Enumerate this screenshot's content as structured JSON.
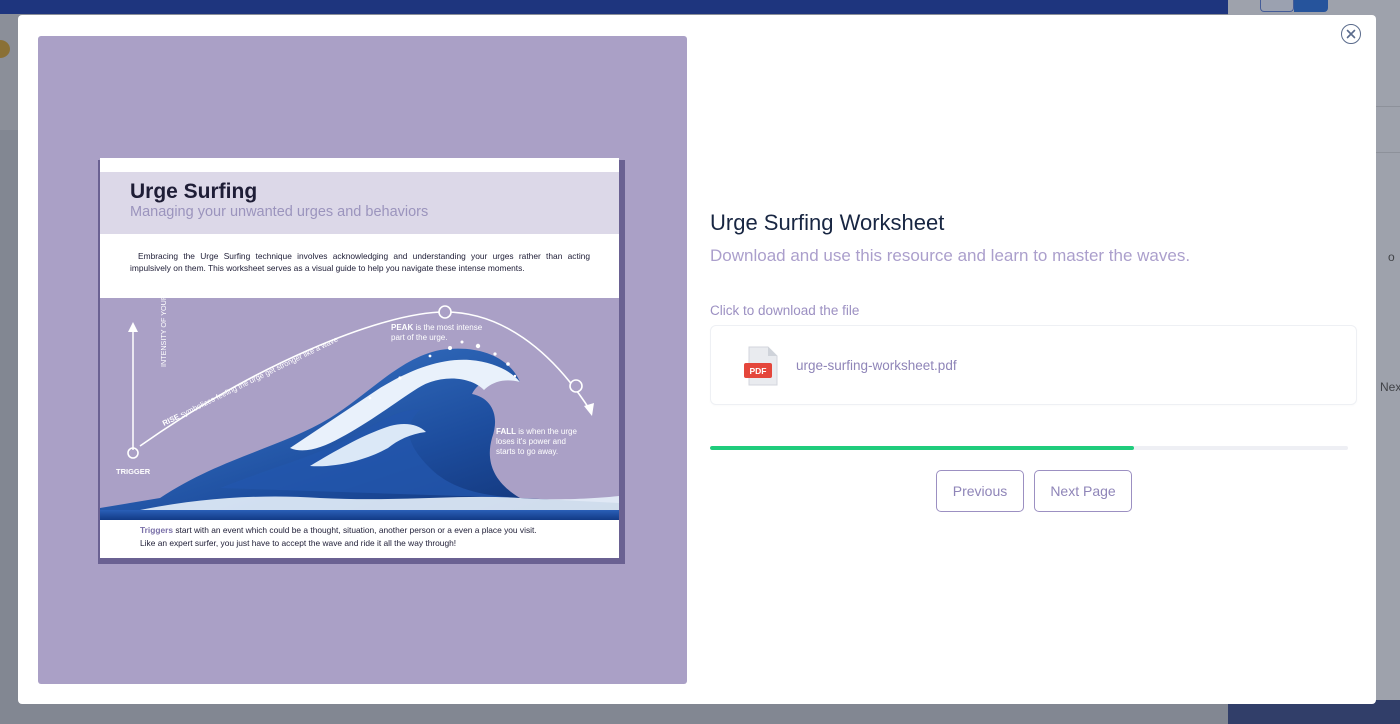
{
  "modal": {
    "close_icon": "close-icon"
  },
  "worksheet": {
    "title": "Urge Surfing",
    "subtitle": "Managing your unwanted urges and behaviors",
    "intro": "Embracing the Urge Surfing technique involves acknowledging and understanding your urges rather than acting impulsively on them. This worksheet serves as a visual guide to help you navigate these intense moments.",
    "axis_label": "INTENSITY OF YOUR URGE",
    "trigger_label": "TRIGGER",
    "rise_bold": "RISE",
    "rise_text": " symbolizes feeling the urge get stronger like a wave",
    "peak_bold": "PEAK",
    "peak_line1": " is the most intense",
    "peak_line2": "part of the urge.",
    "fall_bold": "FALL",
    "fall_line1": " is when the urge",
    "fall_line2": "loses it's power and",
    "fall_line3": "starts to go away.",
    "footer_triggers": "Triggers",
    "footer_line1": " start with an event which could be a thought, situation, another person or a even a place you visit.",
    "footer_line2": "Like an expert surfer, you just have to accept the wave and ride it all the way through!"
  },
  "resource": {
    "title": "Urge Surfing Worksheet",
    "subtitle": "Download and use this resource and learn to master the waves.",
    "download_label": "Click to download the file",
    "file_icon_text": "PDF",
    "file_name": "urge-surfing-worksheet.pdf"
  },
  "progress": {
    "percent": 66.5
  },
  "navigation": {
    "previous_label": "Previous",
    "next_label": "Next Page"
  },
  "background": {
    "right_text_1": "o",
    "right_text_2": "Nex"
  },
  "colors": {
    "preview_bg": "#aaa0c6",
    "progress": "#1fcc7c",
    "accent": "#9c90c2",
    "title": "#182642"
  }
}
